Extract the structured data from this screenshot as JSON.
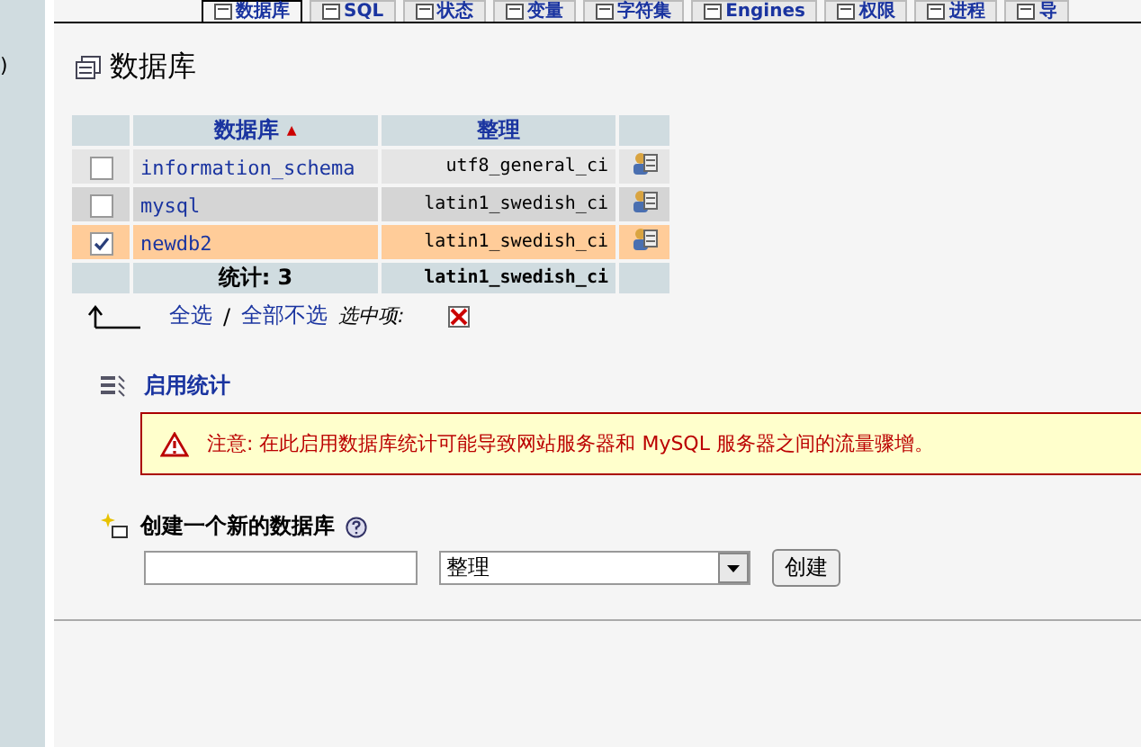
{
  "left_frame": {
    "text": ")"
  },
  "tabs": [
    {
      "label": "数据库",
      "selected": true
    },
    {
      "label": "SQL",
      "selected": false
    },
    {
      "label": "状态",
      "selected": false
    },
    {
      "label": "变量",
      "selected": false
    },
    {
      "label": "字符集",
      "selected": false
    },
    {
      "label": "Engines",
      "selected": false
    },
    {
      "label": "权限",
      "selected": false
    },
    {
      "label": "进程",
      "selected": false
    },
    {
      "label": "导",
      "selected": false
    }
  ],
  "heading": "数据库",
  "table": {
    "columns": [
      "数据库",
      "整理"
    ],
    "sort_mark": "▲",
    "rows": [
      {
        "name": "information_schema",
        "collation": "utf8_general_ci",
        "checked": false,
        "selected": false
      },
      {
        "name": "mysql",
        "collation": "latin1_swedish_ci",
        "checked": false,
        "selected": false
      },
      {
        "name": "newdb2",
        "collation": "latin1_swedish_ci",
        "checked": true,
        "selected": true
      }
    ],
    "footer": {
      "total": "统计: 3",
      "collation": "latin1_swedish_ci"
    }
  },
  "selection": {
    "check_all": "全选",
    "separator": "/",
    "uncheck_all": "全部不选",
    "with_selected": "选中项:"
  },
  "stats": {
    "link": "启用统计",
    "warning": "注意: 在此启用数据库统计可能导致网站服务器和 MySQL 服务器之间的流量骤增。"
  },
  "create": {
    "title": "创建一个新的数据库",
    "collation_select": "整理",
    "button": "创建"
  }
}
